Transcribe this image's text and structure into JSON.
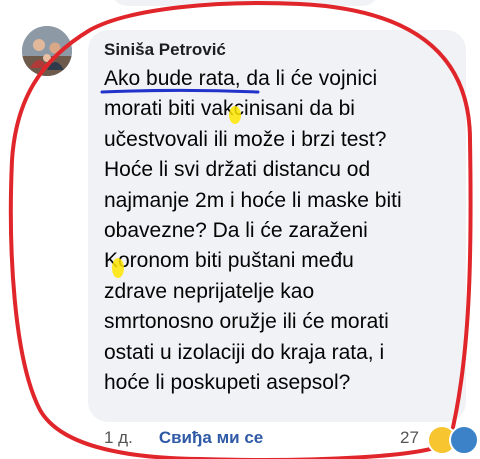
{
  "comment": {
    "author": "Siniša Petrović",
    "lines": [
      "Ako bude rata, da li će vojnici",
      "morati biti vakcinisani da bi",
      "učestvovali ili može i brzi test?",
      "Hoće li svi držati distancu od",
      "najmanje 2m i hoće li maske biti",
      "obavezne? Da li će zaraženi",
      "Koronom biti puštani među",
      "zdrave neprijatelje kao",
      "smrtonosno oružje ili će morati",
      "ostati u izolaciji do kraja rata, i",
      "hoće li poskupeti asepsol?"
    ]
  },
  "footer": {
    "time": "1 д.",
    "like_label": "Свиђа ми се",
    "reaction_count": "27"
  },
  "annotation_colors": {
    "circle": "#e0262b",
    "underline": "#2233cc",
    "highlight": "#ffe600"
  },
  "reaction_icons": [
    "laugh-emoji-icon",
    "wow-emoji-icon"
  ]
}
